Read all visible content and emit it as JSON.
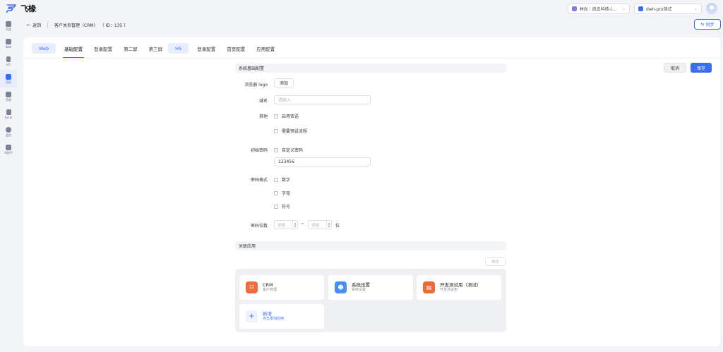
{
  "app": {
    "name": "飞椽"
  },
  "top": {
    "org_select": "林尚｜凯云科技-(...",
    "env_select": "dwh-pro测试"
  },
  "sidebar": {
    "items": [
      {
        "label": "页面",
        "icon": "layers-icon"
      },
      {
        "label": "Web",
        "icon": "monitor-icon"
      },
      {
        "label": "H5",
        "icon": "phone-icon"
      },
      {
        "label": "项目",
        "icon": "grid-icon",
        "active": true
      },
      {
        "label": "资源",
        "icon": "folder-icon"
      },
      {
        "label": "Excel",
        "icon": "excel-icon"
      },
      {
        "label": "监控",
        "icon": "eye-icon"
      },
      {
        "label": "AI助手",
        "icon": "robot-icon"
      }
    ]
  },
  "subheader": {
    "back": "返回",
    "title": "客户关系管理（CRM）",
    "id": "（ ID：135 ）",
    "sync": "同步"
  },
  "tabs": [
    {
      "label": "Web",
      "type": "pill"
    },
    {
      "label": "基础配置",
      "active": true
    },
    {
      "label": "登录配置"
    },
    {
      "label": "第二屏"
    },
    {
      "label": "第三屏"
    },
    {
      "label": "H5",
      "type": "pill"
    },
    {
      "label": "登录配置"
    },
    {
      "label": "首页配置"
    },
    {
      "label": "应用配置"
    }
  ],
  "actions": {
    "cancel": "取消",
    "save": "保存"
  },
  "basic": {
    "section_title": "系统基础配置",
    "logo_label": "浏览器 logo",
    "logo_button": "添加",
    "domain_label": "域名",
    "domain_placeholder": "请输入",
    "other_label": "其他",
    "other_options": [
      "启用双语",
      "需要预设流程"
    ],
    "init_pwd_label": "初始密码",
    "init_pwd_option": "自定义密码",
    "init_pwd_value": "123456",
    "pwd_format_label": "密码格式",
    "pwd_format_options": [
      "数字",
      "字母",
      "符号"
    ],
    "pwd_len_label": "密码位数",
    "pwd_len_min_ph": "请输",
    "pwd_len_sep": "~",
    "pwd_len_max_ph": "请输",
    "pwd_len_unit": "位"
  },
  "apps": {
    "section_title": "关联应用",
    "sort": "排序",
    "cards": [
      {
        "title": "CRM",
        "subtitle": "客户管理",
        "color": "#ee6b3b",
        "icon": "org-chart-icon"
      },
      {
        "title": "系统设置",
        "subtitle": "系统设置",
        "color": "#4a8ef0",
        "icon": "users-icon"
      },
      {
        "title": "开发测试用（测试）",
        "subtitle": "开发测试用",
        "color": "#ea6a3a",
        "icon": "book-icon"
      }
    ],
    "add": {
      "title": "新增",
      "subtitle": "点击添加应用"
    }
  }
}
